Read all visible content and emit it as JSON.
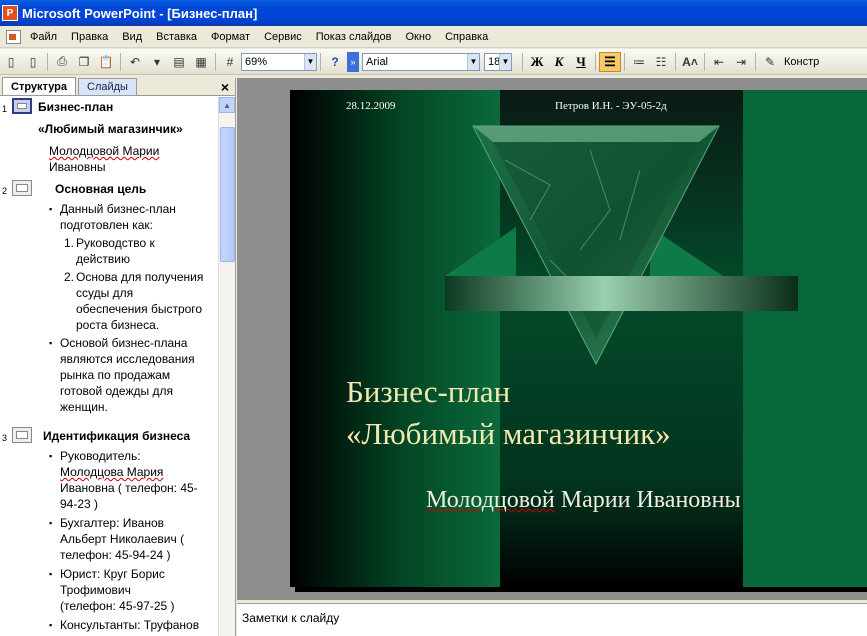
{
  "window": {
    "title": "Microsoft PowerPoint - [Бизнес-план]"
  },
  "menu": [
    "Файл",
    "Правка",
    "Вид",
    "Вставка",
    "Формат",
    "Сервис",
    "Показ слайдов",
    "Окно",
    "Справка"
  ],
  "toolbar": {
    "zoom": "69%",
    "font": "Arial",
    "font_size": "18",
    "bold_label": "Ж",
    "italic_label": "К",
    "underline_label": "Ч",
    "designer_label": "Констр"
  },
  "left_pane": {
    "tabs": [
      "Структура",
      "Слайды"
    ],
    "close": "×",
    "outline": [
      {
        "number": "1",
        "title": "Бизнес-план",
        "lines": [
          "«Любимый магазинчик»"
        ],
        "sub": [
          "Молодцовой Марии",
          "Ивановны"
        ]
      },
      {
        "number": "2",
        "title": "Основная цель",
        "bullets": [
          [
            "Данный бизнес-план",
            "подготовлен как:"
          ],
          [
            "Основой бизнес-плана",
            "являются исследования",
            "рынка по продажам",
            "готовой одежды для",
            "женщин."
          ]
        ],
        "numbered": [
          {
            "n": "1.",
            "lines": [
              "Руководство к",
              "действию"
            ]
          },
          {
            "n": "2.",
            "lines": [
              "Основа для получения",
              "ссуды для",
              "обеспечения быстрого",
              "роста бизнеса."
            ]
          }
        ]
      },
      {
        "number": "3",
        "title": "Идентификация бизнеса",
        "bullets": [
          [
            "Руководитель:",
            "Молодцова Мария",
            "Ивановна ( телефон: 45-",
            "94-23 )"
          ],
          [
            "Бухгалтер: Иванов",
            "Альберт Николаевич  (",
            "телефон: 45-94-24 )"
          ],
          [
            "Юрист: Круг Борис",
            "Трофимович",
            "(телефон: 45-97-25 )"
          ],
          [
            "Консультанты: Труфанов"
          ]
        ]
      }
    ]
  },
  "slide": {
    "date": "28.12.2009",
    "footer": "Петров И.Н. - ЭУ-05-2д",
    "title_line1": "Бизнес-план",
    "title_line2": "«Любимый магазинчик»",
    "subtitle_name": "Молодцовой",
    "subtitle_rest": " Марии Ивановны"
  },
  "notes": {
    "placeholder": "Заметки к слайду"
  }
}
